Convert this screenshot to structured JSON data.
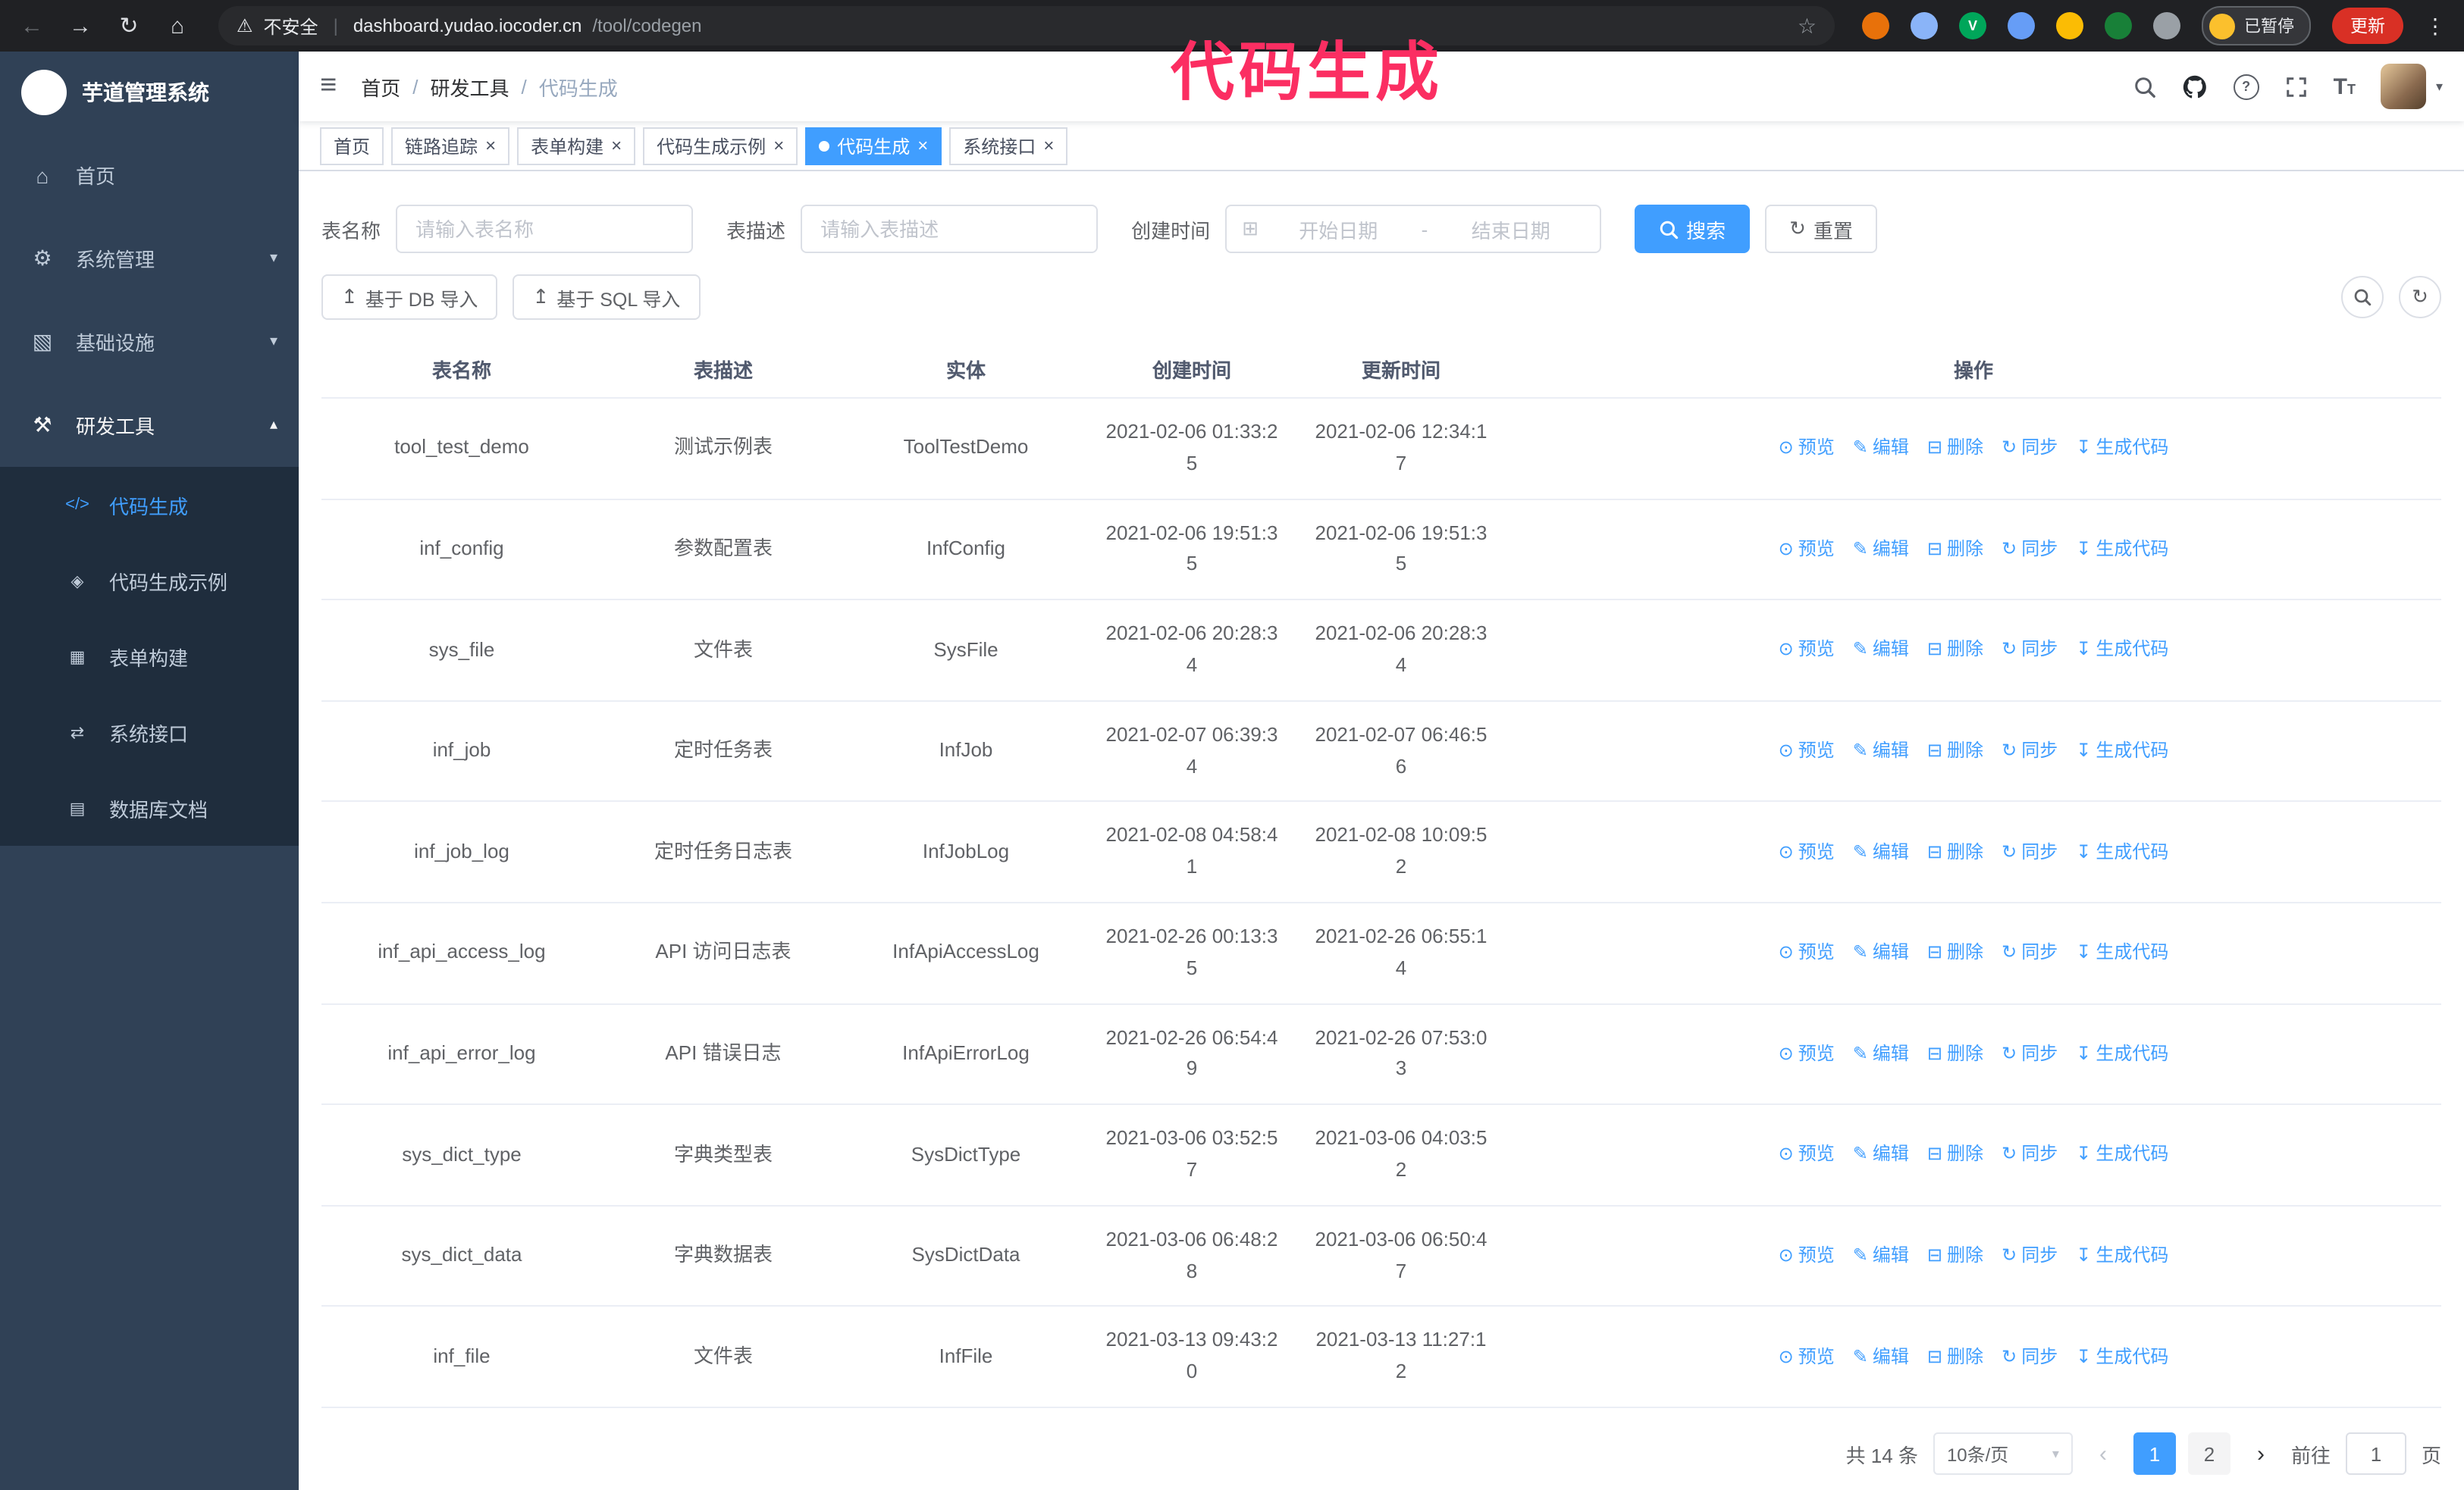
{
  "browser": {
    "security_warning": "不安全",
    "url_domain": "dashboard.yudao.iocoder.cn",
    "url_path": "/tool/codegen",
    "profile_chip": "已暂停",
    "update_button": "更新"
  },
  "annotation": {
    "text": "代码生成",
    "color": "#fb2e62"
  },
  "sidebar": {
    "title": "芋道管理系统",
    "items": [
      {
        "id": "home",
        "label": "首页",
        "icon": "dashboard-icon",
        "glyph": "⌂"
      },
      {
        "id": "system",
        "label": "系统管理",
        "icon": "gear-icon",
        "glyph": "⚙",
        "expandable": true,
        "expanded": false
      },
      {
        "id": "infra",
        "label": "基础设施",
        "icon": "infra-icon",
        "glyph": "▧",
        "expandable": true,
        "expanded": false
      },
      {
        "id": "devtools",
        "label": "研发工具",
        "icon": "tools-icon",
        "glyph": "⚒",
        "expandable": true,
        "expanded": true,
        "children": [
          {
            "id": "codegen",
            "label": "代码生成",
            "icon": "code-icon",
            "glyph": "</>",
            "active": true
          },
          {
            "id": "codegen-example",
            "label": "代码生成示例",
            "icon": "example-icon",
            "glyph": "◈"
          },
          {
            "id": "form-builder",
            "label": "表单构建",
            "icon": "form-icon",
            "glyph": "▦"
          },
          {
            "id": "system-api",
            "label": "系统接口",
            "icon": "api-icon",
            "glyph": "⇄"
          },
          {
            "id": "db-doc",
            "label": "数据库文档",
            "icon": "db-doc-icon",
            "glyph": "▤"
          }
        ]
      }
    ]
  },
  "navbar": {
    "breadcrumb": [
      "首页",
      "研发工具",
      "代码生成"
    ]
  },
  "tabs": [
    {
      "id": "home",
      "label": "首页",
      "closable": false,
      "active": false
    },
    {
      "id": "tracer",
      "label": "链路追踪",
      "closable": true,
      "active": false
    },
    {
      "id": "form-builder",
      "label": "表单构建",
      "closable": true,
      "active": false
    },
    {
      "id": "codegen-example",
      "label": "代码生成示例",
      "closable": true,
      "active": false
    },
    {
      "id": "codegen",
      "label": "代码生成",
      "closable": true,
      "active": true
    },
    {
      "id": "system-api",
      "label": "系统接口",
      "closable": true,
      "active": false
    }
  ],
  "filters": {
    "name_label": "表名称",
    "name_placeholder": "请输入表名称",
    "desc_label": "表描述",
    "desc_placeholder": "请输入表描述",
    "time_label": "创建时间",
    "start_placeholder": "开始日期",
    "separator": "-",
    "end_placeholder": "结束日期",
    "search_button": "搜索",
    "reset_button": "重置"
  },
  "toolbar": {
    "db_import": "基于 DB 导入",
    "sql_import": "基于 SQL 导入"
  },
  "table": {
    "headers": [
      "表名称",
      "表描述",
      "实体",
      "创建时间",
      "更新时间",
      "操作"
    ],
    "actions": [
      {
        "id": "preview",
        "label": "预览",
        "icon": "eye-icon",
        "glyph": "⊙"
      },
      {
        "id": "edit",
        "label": "编辑",
        "icon": "edit-icon",
        "glyph": "✎"
      },
      {
        "id": "delete",
        "label": "删除",
        "icon": "delete-icon",
        "glyph": "⊟"
      },
      {
        "id": "sync",
        "label": "同步",
        "icon": "sync-icon",
        "glyph": "↻"
      },
      {
        "id": "generate",
        "label": "生成代码",
        "icon": "generate-code-icon",
        "glyph": "↧"
      }
    ],
    "rows": [
      {
        "name": "tool_test_demo",
        "desc": "测试示例表",
        "entity": "ToolTestDemo",
        "created": "2021-02-06 01:33:25",
        "updated": "2021-02-06 12:34:17"
      },
      {
        "name": "inf_config",
        "desc": "参数配置表",
        "entity": "InfConfig",
        "created": "2021-02-06 19:51:35",
        "updated": "2021-02-06 19:51:35"
      },
      {
        "name": "sys_file",
        "desc": "文件表",
        "entity": "SysFile",
        "created": "2021-02-06 20:28:34",
        "updated": "2021-02-06 20:28:34"
      },
      {
        "name": "inf_job",
        "desc": "定时任务表",
        "entity": "InfJob",
        "created": "2021-02-07 06:39:34",
        "updated": "2021-02-07 06:46:56"
      },
      {
        "name": "inf_job_log",
        "desc": "定时任务日志表",
        "entity": "InfJobLog",
        "created": "2021-02-08 04:58:41",
        "updated": "2021-02-08 10:09:52"
      },
      {
        "name": "inf_api_access_log",
        "desc": "API 访问日志表",
        "entity": "InfApiAccessLog",
        "created": "2021-02-26 00:13:35",
        "updated": "2021-02-26 06:55:14"
      },
      {
        "name": "inf_api_error_log",
        "desc": "API 错误日志",
        "entity": "InfApiErrorLog",
        "created": "2021-02-26 06:54:49",
        "updated": "2021-02-26 07:53:03"
      },
      {
        "name": "sys_dict_type",
        "desc": "字典类型表",
        "entity": "SysDictType",
        "created": "2021-03-06 03:52:57",
        "updated": "2021-03-06 04:03:52"
      },
      {
        "name": "sys_dict_data",
        "desc": "字典数据表",
        "entity": "SysDictData",
        "created": "2021-03-06 06:48:28",
        "updated": "2021-03-06 06:50:47"
      },
      {
        "name": "inf_file",
        "desc": "文件表",
        "entity": "InfFile",
        "created": "2021-03-13 09:43:20",
        "updated": "2021-03-13 11:27:12"
      }
    ]
  },
  "pagination": {
    "total": "共 14 条",
    "page_size": "10条/页",
    "pages": [
      "1",
      "2"
    ],
    "active_page": "1",
    "goto_label": "前往",
    "goto_value": "1",
    "goto_unit": "页"
  },
  "colors": {
    "accent": "#409eff",
    "sidebar_bg": "#304156",
    "submenu_bg": "#1f2d3d",
    "annotation": "#fb2e62"
  }
}
